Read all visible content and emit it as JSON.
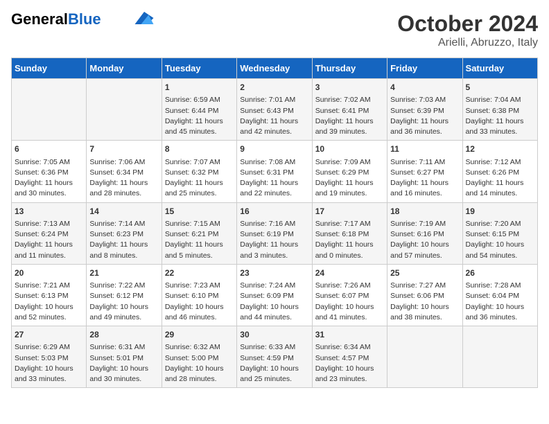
{
  "header": {
    "logo_general": "General",
    "logo_blue": "Blue",
    "month_title": "October 2024",
    "subtitle": "Arielli, Abruzzo, Italy"
  },
  "days_of_week": [
    "Sunday",
    "Monday",
    "Tuesday",
    "Wednesday",
    "Thursday",
    "Friday",
    "Saturday"
  ],
  "weeks": [
    [
      {
        "day": "",
        "data": ""
      },
      {
        "day": "",
        "data": ""
      },
      {
        "day": "1",
        "data": "Sunrise: 6:59 AM\nSunset: 6:44 PM\nDaylight: 11 hours and 45 minutes."
      },
      {
        "day": "2",
        "data": "Sunrise: 7:01 AM\nSunset: 6:43 PM\nDaylight: 11 hours and 42 minutes."
      },
      {
        "day": "3",
        "data": "Sunrise: 7:02 AM\nSunset: 6:41 PM\nDaylight: 11 hours and 39 minutes."
      },
      {
        "day": "4",
        "data": "Sunrise: 7:03 AM\nSunset: 6:39 PM\nDaylight: 11 hours and 36 minutes."
      },
      {
        "day": "5",
        "data": "Sunrise: 7:04 AM\nSunset: 6:38 PM\nDaylight: 11 hours and 33 minutes."
      }
    ],
    [
      {
        "day": "6",
        "data": "Sunrise: 7:05 AM\nSunset: 6:36 PM\nDaylight: 11 hours and 30 minutes."
      },
      {
        "day": "7",
        "data": "Sunrise: 7:06 AM\nSunset: 6:34 PM\nDaylight: 11 hours and 28 minutes."
      },
      {
        "day": "8",
        "data": "Sunrise: 7:07 AM\nSunset: 6:32 PM\nDaylight: 11 hours and 25 minutes."
      },
      {
        "day": "9",
        "data": "Sunrise: 7:08 AM\nSunset: 6:31 PM\nDaylight: 11 hours and 22 minutes."
      },
      {
        "day": "10",
        "data": "Sunrise: 7:09 AM\nSunset: 6:29 PM\nDaylight: 11 hours and 19 minutes."
      },
      {
        "day": "11",
        "data": "Sunrise: 7:11 AM\nSunset: 6:27 PM\nDaylight: 11 hours and 16 minutes."
      },
      {
        "day": "12",
        "data": "Sunrise: 7:12 AM\nSunset: 6:26 PM\nDaylight: 11 hours and 14 minutes."
      }
    ],
    [
      {
        "day": "13",
        "data": "Sunrise: 7:13 AM\nSunset: 6:24 PM\nDaylight: 11 hours and 11 minutes."
      },
      {
        "day": "14",
        "data": "Sunrise: 7:14 AM\nSunset: 6:23 PM\nDaylight: 11 hours and 8 minutes."
      },
      {
        "day": "15",
        "data": "Sunrise: 7:15 AM\nSunset: 6:21 PM\nDaylight: 11 hours and 5 minutes."
      },
      {
        "day": "16",
        "data": "Sunrise: 7:16 AM\nSunset: 6:19 PM\nDaylight: 11 hours and 3 minutes."
      },
      {
        "day": "17",
        "data": "Sunrise: 7:17 AM\nSunset: 6:18 PM\nDaylight: 11 hours and 0 minutes."
      },
      {
        "day": "18",
        "data": "Sunrise: 7:19 AM\nSunset: 6:16 PM\nDaylight: 10 hours and 57 minutes."
      },
      {
        "day": "19",
        "data": "Sunrise: 7:20 AM\nSunset: 6:15 PM\nDaylight: 10 hours and 54 minutes."
      }
    ],
    [
      {
        "day": "20",
        "data": "Sunrise: 7:21 AM\nSunset: 6:13 PM\nDaylight: 10 hours and 52 minutes."
      },
      {
        "day": "21",
        "data": "Sunrise: 7:22 AM\nSunset: 6:12 PM\nDaylight: 10 hours and 49 minutes."
      },
      {
        "day": "22",
        "data": "Sunrise: 7:23 AM\nSunset: 6:10 PM\nDaylight: 10 hours and 46 minutes."
      },
      {
        "day": "23",
        "data": "Sunrise: 7:24 AM\nSunset: 6:09 PM\nDaylight: 10 hours and 44 minutes."
      },
      {
        "day": "24",
        "data": "Sunrise: 7:26 AM\nSunset: 6:07 PM\nDaylight: 10 hours and 41 minutes."
      },
      {
        "day": "25",
        "data": "Sunrise: 7:27 AM\nSunset: 6:06 PM\nDaylight: 10 hours and 38 minutes."
      },
      {
        "day": "26",
        "data": "Sunrise: 7:28 AM\nSunset: 6:04 PM\nDaylight: 10 hours and 36 minutes."
      }
    ],
    [
      {
        "day": "27",
        "data": "Sunrise: 6:29 AM\nSunset: 5:03 PM\nDaylight: 10 hours and 33 minutes."
      },
      {
        "day": "28",
        "data": "Sunrise: 6:31 AM\nSunset: 5:01 PM\nDaylight: 10 hours and 30 minutes."
      },
      {
        "day": "29",
        "data": "Sunrise: 6:32 AM\nSunset: 5:00 PM\nDaylight: 10 hours and 28 minutes."
      },
      {
        "day": "30",
        "data": "Sunrise: 6:33 AM\nSunset: 4:59 PM\nDaylight: 10 hours and 25 minutes."
      },
      {
        "day": "31",
        "data": "Sunrise: 6:34 AM\nSunset: 4:57 PM\nDaylight: 10 hours and 23 minutes."
      },
      {
        "day": "",
        "data": ""
      },
      {
        "day": "",
        "data": ""
      }
    ]
  ]
}
